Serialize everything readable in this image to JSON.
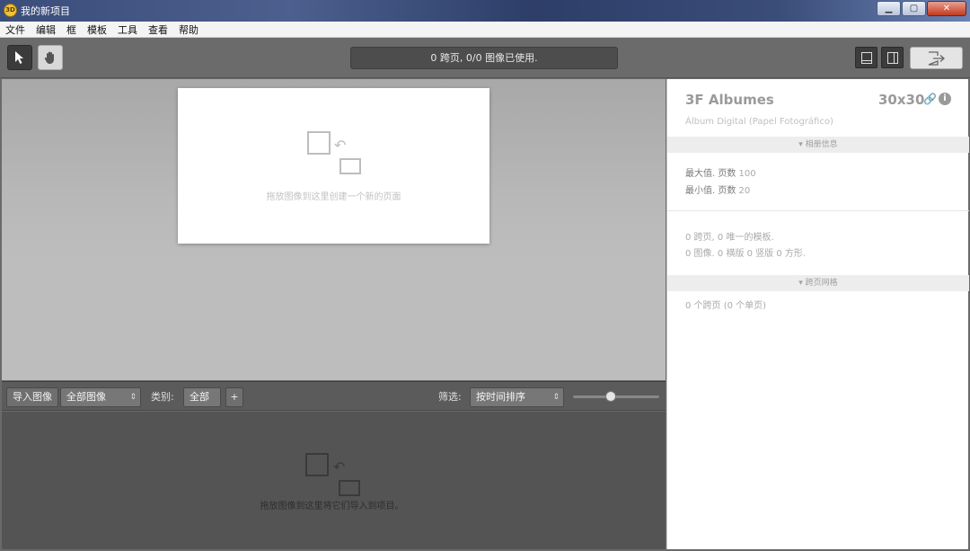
{
  "window": {
    "title": "我的新项目",
    "app_icon": "3D"
  },
  "menu": [
    "文件",
    "编辑",
    "框",
    "模板",
    "工具",
    "查看",
    "帮助"
  ],
  "toolbar": {
    "status": "0 跨页, 0/0 图像已使用."
  },
  "canvas": {
    "drop_hint": "拖放图像到这里创建一个新的页面"
  },
  "panel": {
    "title": "3F Albumes",
    "size": "30x30",
    "subtitle": "Álbum Digital (Papel Fotográfico)",
    "section1": "▾ 相册信息",
    "max_label": "最大值. 页数",
    "max_value": "100",
    "min_label": "最小值. 页数",
    "min_value": "20",
    "stats1": "0 跨页, 0 唯一的模板.",
    "stats2": "0 图像. 0 横版 0 竖版 0 方形.",
    "section2": "▾ 跨页网格",
    "grid_info": "0 个跨页 (0 个单页)"
  },
  "browser": {
    "import_label": "导入图像",
    "all_images": "全部图像",
    "category_label": "类别:",
    "category_value": "全部",
    "add_label": "+",
    "filter_label": "筛选:",
    "sort_value": "按时间排序",
    "drop_hint": "拖放图像到这里将它们导入到项目。"
  },
  "slider": {
    "value": 0.44
  }
}
